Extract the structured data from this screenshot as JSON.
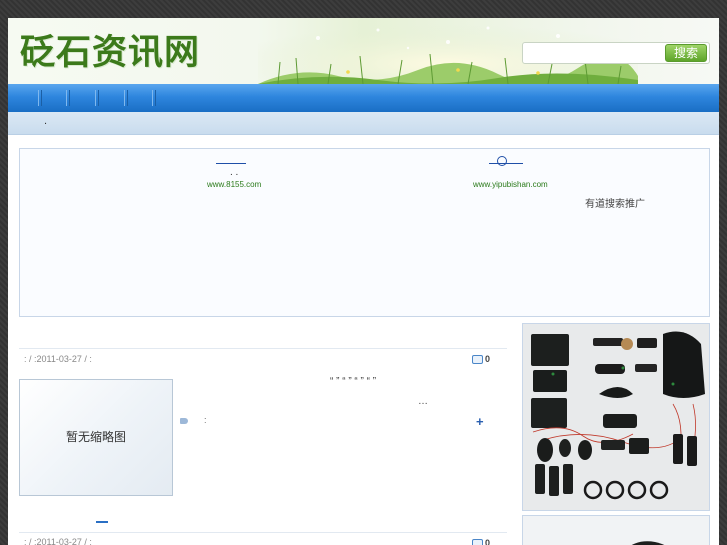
{
  "header": {
    "logo": "砭石资讯网"
  },
  "search": {
    "placeholder": "",
    "button_label": "搜索"
  },
  "nav": {
    "items": [
      "",
      "",
      "",
      "",
      ""
    ]
  },
  "breadcrumb": ".",
  "ads": {
    "left": {
      "dots": ". .",
      "url": "www.8155.com"
    },
    "right": {
      "url": "www.yipubishan.com"
    },
    "promo": "有道搜索推广"
  },
  "article": {
    "meta": ":   /  :2011-03-27 /  :",
    "comments": "0",
    "thumbnail_text": "暂无缩略图",
    "summary_line1": "“ ”    “ ”    “ ”                      “ ”",
    "summary_line2": "…",
    "tags_label": ":",
    "more": "+"
  },
  "article2": {
    "meta": ":   /  :2011-03-27 /  :",
    "comments": "0"
  },
  "colors": {
    "nav_blue": "#2e86de",
    "logo_green": "#3c7a1b",
    "link_blue": "#1f4fa8"
  }
}
